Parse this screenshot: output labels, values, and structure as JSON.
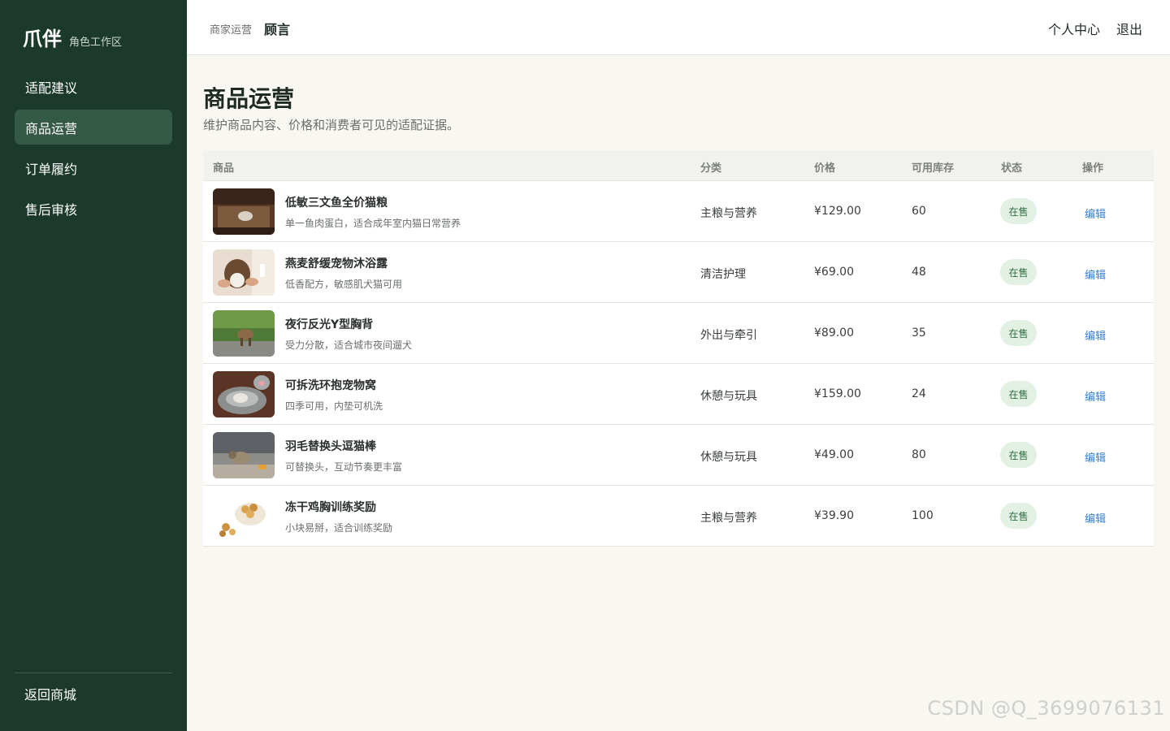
{
  "brand": {
    "name": "爪伴",
    "subtitle": "角色工作区"
  },
  "sidebar": {
    "items": [
      {
        "label": "适配建议",
        "active": false
      },
      {
        "label": "商品运营",
        "active": true
      },
      {
        "label": "订单履约",
        "active": false
      },
      {
        "label": "售后审核",
        "active": false
      }
    ],
    "back_label": "返回商城"
  },
  "header": {
    "breadcrumb_parent": "商家运营",
    "breadcrumb_current": "顾言",
    "profile_label": "个人中心",
    "logout_label": "退出"
  },
  "page": {
    "title": "商品运营",
    "description": "维护商品内容、价格和消费者可见的适配证据。"
  },
  "table": {
    "columns": [
      "商品",
      "分类",
      "价格",
      "可用库存",
      "状态",
      "操作"
    ],
    "rows": [
      {
        "name": "低敏三文鱼全价猫粮",
        "desc": "单一鱼肉蛋白，适合成年室内猫日常营养",
        "category": "主粮与营养",
        "price": "¥129.00",
        "stock": "60",
        "status": "在售",
        "action": "编辑"
      },
      {
        "name": "燕麦舒缓宠物沐浴露",
        "desc": "低香配方，敏感肌犬猫可用",
        "category": "清洁护理",
        "price": "¥69.00",
        "stock": "48",
        "status": "在售",
        "action": "编辑"
      },
      {
        "name": "夜行反光Y型胸背",
        "desc": "受力分散，适合城市夜间遛犬",
        "category": "外出与牵引",
        "price": "¥89.00",
        "stock": "35",
        "status": "在售",
        "action": "编辑"
      },
      {
        "name": "可拆洗环抱宠物窝",
        "desc": "四季可用，内垫可机洗",
        "category": "休憩与玩具",
        "price": "¥159.00",
        "stock": "24",
        "status": "在售",
        "action": "编辑"
      },
      {
        "name": "羽毛替换头逗猫棒",
        "desc": "可替换头，互动节奏更丰富",
        "category": "休憩与玩具",
        "price": "¥49.00",
        "stock": "80",
        "status": "在售",
        "action": "编辑"
      },
      {
        "name": "冻干鸡胸训练奖励",
        "desc": "小块易掰，适合训练奖励",
        "category": "主粮与营养",
        "price": "¥39.90",
        "stock": "100",
        "status": "在售",
        "action": "编辑"
      }
    ]
  },
  "watermark": "CSDN @Q_3699076131",
  "colors": {
    "sidebar_bg": "#1b3a2c",
    "sidebar_active": "#345947",
    "page_bg": "#f9f7f1",
    "badge_bg": "#e3f1e4",
    "badge_text": "#2f6d3f",
    "link": "#2f80d8"
  }
}
